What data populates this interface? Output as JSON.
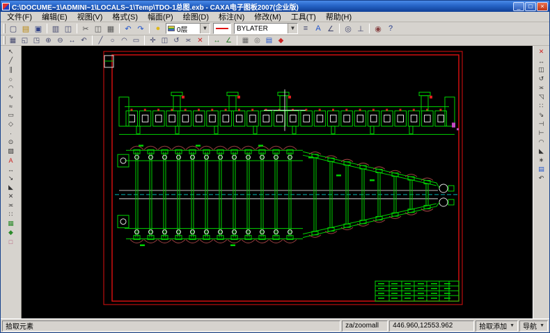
{
  "window": {
    "title": "C:\\DOCUME~1\\ADMINI~1\\LOCALS~1\\Temp\\TDO-1总图.exb - CAXA电子图板2007(企业版)",
    "controls": {
      "minimize": "_",
      "maximize": "□",
      "close": "×"
    }
  },
  "menu": {
    "items": [
      {
        "name": "menu-file",
        "label": "文件(F)"
      },
      {
        "name": "menu-edit",
        "label": "编辑(E)"
      },
      {
        "name": "menu-view",
        "label": "视图(V)"
      },
      {
        "name": "menu-format",
        "label": "格式(S)"
      },
      {
        "name": "menu-sheet",
        "label": "幅面(P)"
      },
      {
        "name": "menu-draw",
        "label": "绘图(D)"
      },
      {
        "name": "menu-dimension",
        "label": "标注(N)"
      },
      {
        "name": "menu-modify",
        "label": "修改(M)"
      },
      {
        "name": "menu-tools",
        "label": "工具(T)"
      },
      {
        "name": "menu-help",
        "label": "帮助(H)"
      }
    ]
  },
  "toolbar1": {
    "left_buttons": [
      {
        "name": "new-button",
        "glyph": "▢",
        "color": "#44486e"
      },
      {
        "name": "open-button",
        "glyph": "▤",
        "color": "#b8860b"
      },
      {
        "name": "save-button",
        "glyph": "▣",
        "color": "#334488"
      },
      {
        "sep": true
      },
      {
        "name": "print-button",
        "glyph": "▥",
        "color": "#44486e"
      },
      {
        "name": "print-preview-button",
        "glyph": "◫",
        "color": "#44486e"
      },
      {
        "sep": true
      },
      {
        "name": "cut-button",
        "glyph": "✂",
        "color": "#555555"
      },
      {
        "name": "copy-button",
        "glyph": "◫",
        "color": "#555555"
      },
      {
        "name": "paste-button",
        "glyph": "▦",
        "color": "#555555"
      },
      {
        "sep": true
      },
      {
        "name": "undo-button",
        "glyph": "↶",
        "color": "#2255cc"
      },
      {
        "name": "redo-button",
        "glyph": "↷",
        "color": "#2255cc"
      },
      {
        "sep": true
      },
      {
        "name": "redraw-bulb-button",
        "glyph": "●",
        "color": "#e0b818"
      }
    ],
    "layer_combo": {
      "value": "0层"
    },
    "linetype_combo": {
      "value": "BYLATER"
    },
    "color_value": "#e01010",
    "right_buttons": [
      {
        "name": "linewidth-button",
        "glyph": "≡",
        "color": "#44486e"
      },
      {
        "name": "textstyle-button",
        "glyph": "A",
        "color": "#2255cc"
      },
      {
        "name": "dimstyle-button",
        "glyph": "∠",
        "color": "#44486e"
      },
      {
        "sep": true
      },
      {
        "name": "point-snap-button",
        "glyph": "◎",
        "color": "#44486e"
      },
      {
        "name": "ortho-button",
        "glyph": "⊥",
        "color": "#44486e"
      },
      {
        "sep": true
      },
      {
        "name": "query-button",
        "glyph": "◉",
        "color": "#884444"
      },
      {
        "name": "help-button",
        "glyph": "?",
        "color": "#223a8c"
      }
    ]
  },
  "toolbar2": {
    "buttons": [
      {
        "name": "redraw-button",
        "glyph": "▦",
        "color": "#44486e"
      },
      {
        "name": "zoom-window-button",
        "glyph": "◱",
        "color": "#44486e"
      },
      {
        "name": "zoom-all-button",
        "glyph": "◳",
        "color": "#44486e"
      },
      {
        "name": "zoom-in-button",
        "glyph": "⊕",
        "color": "#44486e"
      },
      {
        "name": "zoom-out-button",
        "glyph": "⊖",
        "color": "#44486e"
      },
      {
        "name": "pan-button",
        "glyph": "↔",
        "color": "#44486e"
      },
      {
        "name": "prev-view-button",
        "glyph": "↶",
        "color": "#44486e"
      },
      {
        "sep": true
      },
      {
        "name": "line-button",
        "glyph": "╱",
        "color": "#44486e"
      },
      {
        "name": "circle-button",
        "glyph": "○",
        "color": "#44486e"
      },
      {
        "name": "arc-button",
        "glyph": "◠",
        "color": "#44486e"
      },
      {
        "name": "rect-button",
        "glyph": "▭",
        "color": "#44486e"
      },
      {
        "sep": true
      },
      {
        "name": "move-button",
        "glyph": "✛",
        "color": "#44486e"
      },
      {
        "name": "copy2-button",
        "glyph": "◫",
        "color": "#44486e"
      },
      {
        "name": "rotate-button",
        "glyph": "↺",
        "color": "#44486e"
      },
      {
        "name": "mirror-button",
        "glyph": "≍",
        "color": "#44486e"
      },
      {
        "name": "delete-button",
        "glyph": "✕",
        "color": "#cc2222"
      },
      {
        "sep": true
      },
      {
        "name": "dim-linear-button",
        "glyph": "↔",
        "color": "#2a7a2a"
      },
      {
        "name": "dim-angle-button",
        "glyph": "∠",
        "color": "#2a7a2a"
      },
      {
        "sep": true
      },
      {
        "name": "grid-button",
        "glyph": "▦",
        "color": "#666666"
      },
      {
        "name": "snap-button",
        "glyph": "◎",
        "color": "#666666"
      },
      {
        "name": "settings-button",
        "glyph": "▤",
        "color": "#2255cc"
      },
      {
        "name": "about-button",
        "glyph": "◆",
        "color": "#cc2222"
      }
    ]
  },
  "left_toolbar": {
    "tools": [
      {
        "name": "select-tool",
        "glyph": "↖",
        "color": "#333333"
      },
      {
        "name": "line-tool",
        "glyph": "╱",
        "color": "#333333"
      },
      {
        "name": "parallel-tool",
        "glyph": "∥",
        "color": "#333333"
      },
      {
        "name": "circle-tool",
        "glyph": "○",
        "color": "#333333"
      },
      {
        "name": "arc-tool",
        "glyph": "◠",
        "color": "#333333"
      },
      {
        "name": "spline-tool",
        "glyph": "∿",
        "color": "#333333"
      },
      {
        "name": "polyline-tool",
        "glyph": "≈",
        "color": "#333333"
      },
      {
        "name": "rect-tool",
        "glyph": "▭",
        "color": "#333333"
      },
      {
        "name": "polygon-tool",
        "glyph": "◇",
        "color": "#333333"
      },
      {
        "name": "point-tool",
        "glyph": "·",
        "color": "#333333"
      },
      {
        "name": "ellipse-tool",
        "glyph": "⊙",
        "color": "#333333"
      },
      {
        "name": "hatch-tool",
        "glyph": "▨",
        "color": "#333333"
      },
      {
        "name": "text-tool",
        "glyph": "A",
        "color": "#cc2222"
      },
      {
        "name": "dim-tool",
        "glyph": "↔",
        "color": "#333333"
      },
      {
        "name": "leader-tool",
        "glyph": "↘",
        "color": "#333333"
      },
      {
        "name": "chamfer-tool",
        "glyph": "◣",
        "color": "#333333"
      },
      {
        "name": "break-tool",
        "glyph": "✕",
        "color": "#333333"
      },
      {
        "name": "mirror-tool",
        "glyph": "≍",
        "color": "#333333"
      },
      {
        "name": "array-tool",
        "glyph": "∷",
        "color": "#333333"
      },
      {
        "name": "block-tool",
        "glyph": "▦",
        "color": "#2a8a2a"
      },
      {
        "name": "library-tool",
        "glyph": "◆",
        "color": "#2a8a2a"
      },
      {
        "name": "eraser-tool",
        "glyph": "□",
        "color": "#b05070"
      }
    ]
  },
  "right_toolbar": {
    "tools": [
      {
        "name": "delete-tool",
        "glyph": "✕",
        "color": "#cc2222"
      },
      {
        "name": "move-tool",
        "glyph": "↔",
        "color": "#333333"
      },
      {
        "name": "copy-tool",
        "glyph": "◫",
        "color": "#333333"
      },
      {
        "name": "rotate-tool",
        "glyph": "↺",
        "color": "#333333"
      },
      {
        "name": "mirror2-tool",
        "glyph": "≍",
        "color": "#333333"
      },
      {
        "name": "scale-tool",
        "glyph": "◹",
        "color": "#333333"
      },
      {
        "name": "array2-tool",
        "glyph": "∷",
        "color": "#333333"
      },
      {
        "name": "stretch-tool",
        "glyph": "⇘",
        "color": "#333333"
      },
      {
        "name": "trim-tool",
        "glyph": "⊣",
        "color": "#333333"
      },
      {
        "name": "extend-tool",
        "glyph": "⊢",
        "color": "#333333"
      },
      {
        "name": "fillet-tool",
        "glyph": "◠",
        "color": "#333333"
      },
      {
        "name": "chamfer2-tool",
        "glyph": "◣",
        "color": "#333333"
      },
      {
        "name": "explode-tool",
        "glyph": "∗",
        "color": "#333333"
      },
      {
        "name": "properties-tool",
        "glyph": "▤",
        "color": "#2255cc"
      },
      {
        "name": "undo2-tool",
        "glyph": "↶",
        "color": "#333333"
      }
    ]
  },
  "statusbar": {
    "prompt": "拾取元素",
    "command": "za/zoomall",
    "coordinates": "446.960,12553.962",
    "pick_mode": "拾取添加",
    "nav_mode": "导航"
  },
  "canvas": {
    "colors": {
      "background": "#000000",
      "frame": "#e01010",
      "line": "#00d400",
      "white": "#dcdcdc",
      "cyan": "#00b7b7",
      "chain": "#9c4040",
      "red": "#e02020",
      "magenta": "#c44ac4"
    }
  }
}
